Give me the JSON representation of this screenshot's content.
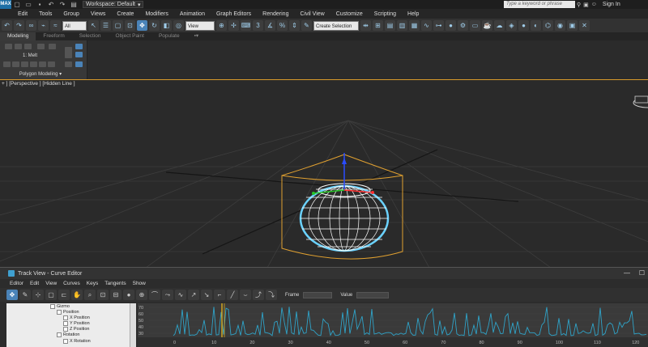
{
  "titlebar": {
    "workspace_label": "Workspace: Default",
    "search_placeholder": "Type a keyword or phrase",
    "signin_label": "Sign In"
  },
  "menubar": {
    "items": [
      "Edit",
      "Tools",
      "Group",
      "Views",
      "Create",
      "Modifiers",
      "Animation",
      "Graph Editors",
      "Rendering",
      "Civil View",
      "Customize",
      "Scripting",
      "Help"
    ]
  },
  "toolbar": {
    "filter_value": "All",
    "view_value": "View",
    "selection_set": "Create Selection Se"
  },
  "ribbon": {
    "tabs": [
      "Modeling",
      "Freeform",
      "Selection",
      "Object Paint",
      "Populate"
    ],
    "modifier_label": "1: Melt",
    "panel_label": "Polygon Modeling"
  },
  "viewport": {
    "label": "+ ] [Perspective ] [Hidden Line ]"
  },
  "curve_editor": {
    "title": "Track View - Curve Editor",
    "menu": [
      "Editor",
      "Edit",
      "View",
      "Curves",
      "Keys",
      "Tangents",
      "Show"
    ],
    "frame_label": "Frame",
    "value_label": "Value",
    "tree": [
      "Gizmo",
      "Position",
      "X Position",
      "Y Position",
      "Z Position",
      "Rotation",
      "X Rotation"
    ],
    "axis_y_ticks": [
      "70",
      "60",
      "50",
      "40",
      "30"
    ],
    "axis_x_ticks": [
      "0",
      "10",
      "20",
      "30",
      "40",
      "50",
      "60",
      "70",
      "80",
      "90",
      "100",
      "110",
      "120"
    ],
    "colors": {
      "curve": "#2fa3c8",
      "key_marker": "#d2a41e"
    }
  }
}
